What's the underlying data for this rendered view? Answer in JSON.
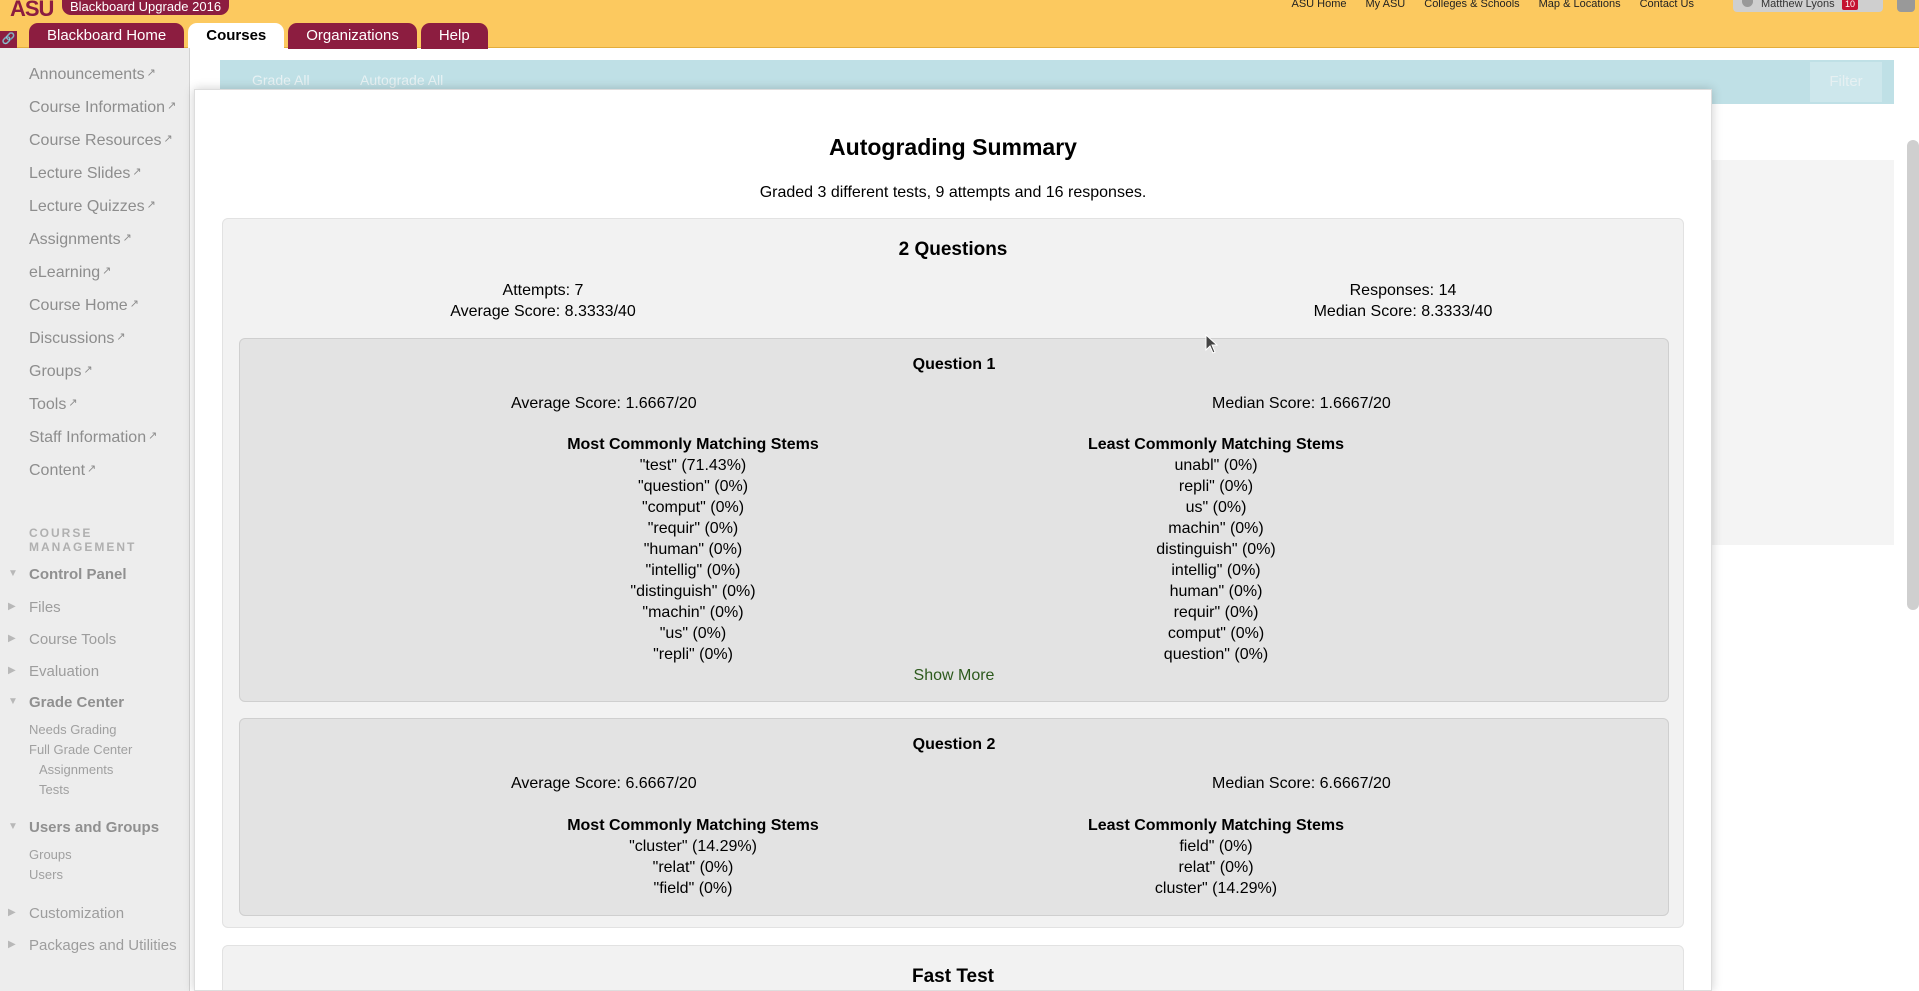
{
  "header": {
    "logo": "ASU",
    "brand": "Blackboard Upgrade 2016",
    "top_links": [
      "ASU Home",
      "My ASU",
      "Colleges & Schools",
      "Map & Locations",
      "Contact Us"
    ],
    "user_name": "Matthew Lyons",
    "user_count": "10",
    "tabs": [
      {
        "label": "Blackboard Home",
        "active": false
      },
      {
        "label": "Courses",
        "active": true
      },
      {
        "label": "Organizations",
        "active": false
      },
      {
        "label": "Help",
        "active": false
      }
    ]
  },
  "sidebar": {
    "course_items": [
      "Announcements",
      "Course Information",
      "Course Resources",
      "Lecture Slides",
      "Lecture Quizzes",
      "Assignments",
      "eLearning",
      "Course Home",
      "Discussions",
      "Groups",
      "Tools",
      "Staff Information",
      "Content"
    ],
    "management_label": "COURSE MANAGEMENT",
    "control_panel": "Control Panel",
    "files": "Files",
    "course_tools": "Course Tools",
    "evaluation": "Evaluation",
    "grade_center": "Grade Center",
    "grade_center_items": [
      "Needs Grading",
      "Full Grade Center"
    ],
    "grade_center_subitems": [
      "Assignments",
      "Tests"
    ],
    "users_and_groups": "Users and Groups",
    "users_items": [
      "Groups",
      "Users"
    ],
    "customization": "Customization",
    "packages": "Packages and Utilities"
  },
  "background": {
    "grade_all": "Grade All",
    "autograde_all": "Autograde All",
    "filter": "Filter"
  },
  "modal": {
    "title": "Autograding Summary",
    "subtitle": "Graded 3 different tests, 9 attempts and 16 responses.",
    "test1": {
      "title": "2 Questions",
      "attempts": "Attempts: 7",
      "average": "Average Score: 8.3333/40",
      "responses": "Responses: 14",
      "median": "Median Score: 8.3333/40",
      "q1": {
        "title": "Question 1",
        "average": "Average Score: 1.6667/20",
        "median": "Median Score: 1.6667/20",
        "most_head": "Most Commonly Matching Stems",
        "least_head": "Least Commonly Matching Stems",
        "most": [
          "\"test\" (71.43%)",
          "\"question\" (0%)",
          "\"comput\" (0%)",
          "\"requir\" (0%)",
          "\"human\" (0%)",
          "\"intellig\" (0%)",
          "\"distinguish\" (0%)",
          "\"machin\" (0%)",
          "\"us\" (0%)",
          "\"repli\" (0%)"
        ],
        "least": [
          "unabl\" (0%)",
          "repli\" (0%)",
          "us\" (0%)",
          "machin\" (0%)",
          "distinguish\" (0%)",
          "intellig\" (0%)",
          "human\" (0%)",
          "requir\" (0%)",
          "comput\" (0%)",
          "question\" (0%)"
        ],
        "show_more": "Show More"
      },
      "q2": {
        "title": "Question 2",
        "average": "Average Score: 6.6667/20",
        "median": "Median Score: 6.6667/20",
        "most_head": "Most Commonly Matching Stems",
        "least_head": "Least Commonly Matching Stems",
        "most": [
          "\"cluster\" (14.29%)",
          "\"relat\" (0%)",
          "\"field\" (0%)"
        ],
        "least": [
          "field\" (0%)",
          "relat\" (0%)",
          "cluster\" (14.29%)"
        ]
      }
    },
    "test2": {
      "title": "Fast Test"
    }
  }
}
